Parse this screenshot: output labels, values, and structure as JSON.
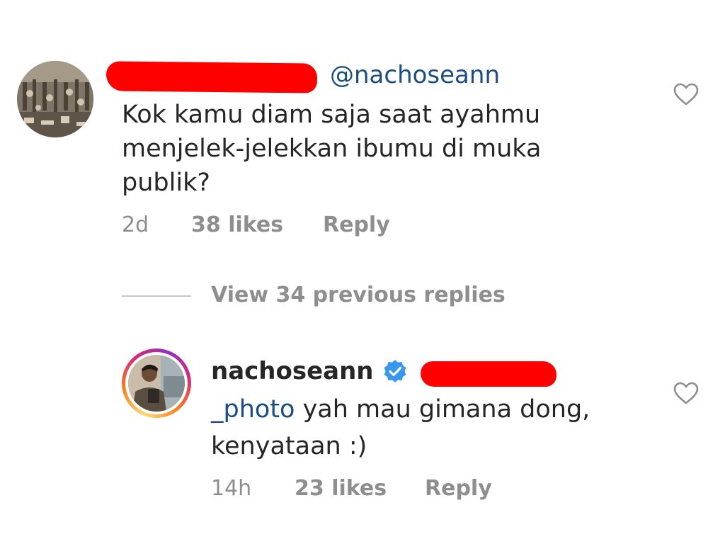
{
  "comment": {
    "username": "",
    "mention": "@nachoseann",
    "text": "Kok kamu diam saja saat ayahmu menjelek-jelekkan ibumu di muka publik?",
    "time": "2d",
    "likes": "38 likes",
    "reply_label": "Reply",
    "avatar_icon": "crowd-photo-avatar",
    "like_icon": "heart-outline-icon"
  },
  "view_replies": "View 34 previous replies",
  "reply": {
    "username": "nachoseann",
    "verified_icon": "verified-badge-icon",
    "mention_tail": "_photo",
    "text": " yah mau gimana dong, kenyataan :)",
    "time": "14h",
    "likes": "23 likes",
    "reply_label": "Reply",
    "avatar_icon": "portrait-photo-avatar",
    "like_icon": "heart-outline-icon"
  },
  "colors": {
    "text": "#262626",
    "muted": "#8e8e8e",
    "mention": "#1b4d81",
    "verified": "#3897f0",
    "redaction": "#ff0000"
  }
}
